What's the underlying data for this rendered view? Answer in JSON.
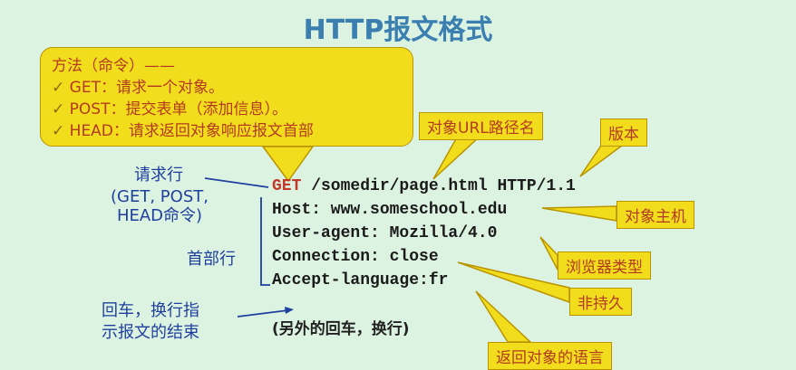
{
  "title": "HTTP报文格式",
  "method_callout": {
    "heading": "方法（命令）——",
    "items": [
      "GET：请求一个对象。",
      "POST：提交表单（添加信息）。",
      "HEAD：请求返回对象响应报文首部"
    ]
  },
  "request_lines": {
    "method": "GET",
    "request_rest": " /somedir/page.html HTTP/1.1",
    "host": "Host: www.someschool.edu",
    "user_agent": "User-agent: Mozilla/4.0",
    "connection": "Connection: close",
    "accept_language": "Accept-language:fr"
  },
  "callouts": {
    "url": "对象URL路径名",
    "version": "版本",
    "host": "对象主机",
    "browser": "浏览器类型",
    "nonpersistent": "非持久",
    "language": "返回对象的语言"
  },
  "labels": {
    "request_line": "请求行",
    "request_line_detail_1": "(GET, POST,",
    "request_line_detail_2": "HEAD命令)",
    "header_lines": "首部行",
    "crlf_1": "回车，换行指",
    "crlf_2": "示报文的结束",
    "extra_crlf": "(另外的回车，换行)"
  }
}
